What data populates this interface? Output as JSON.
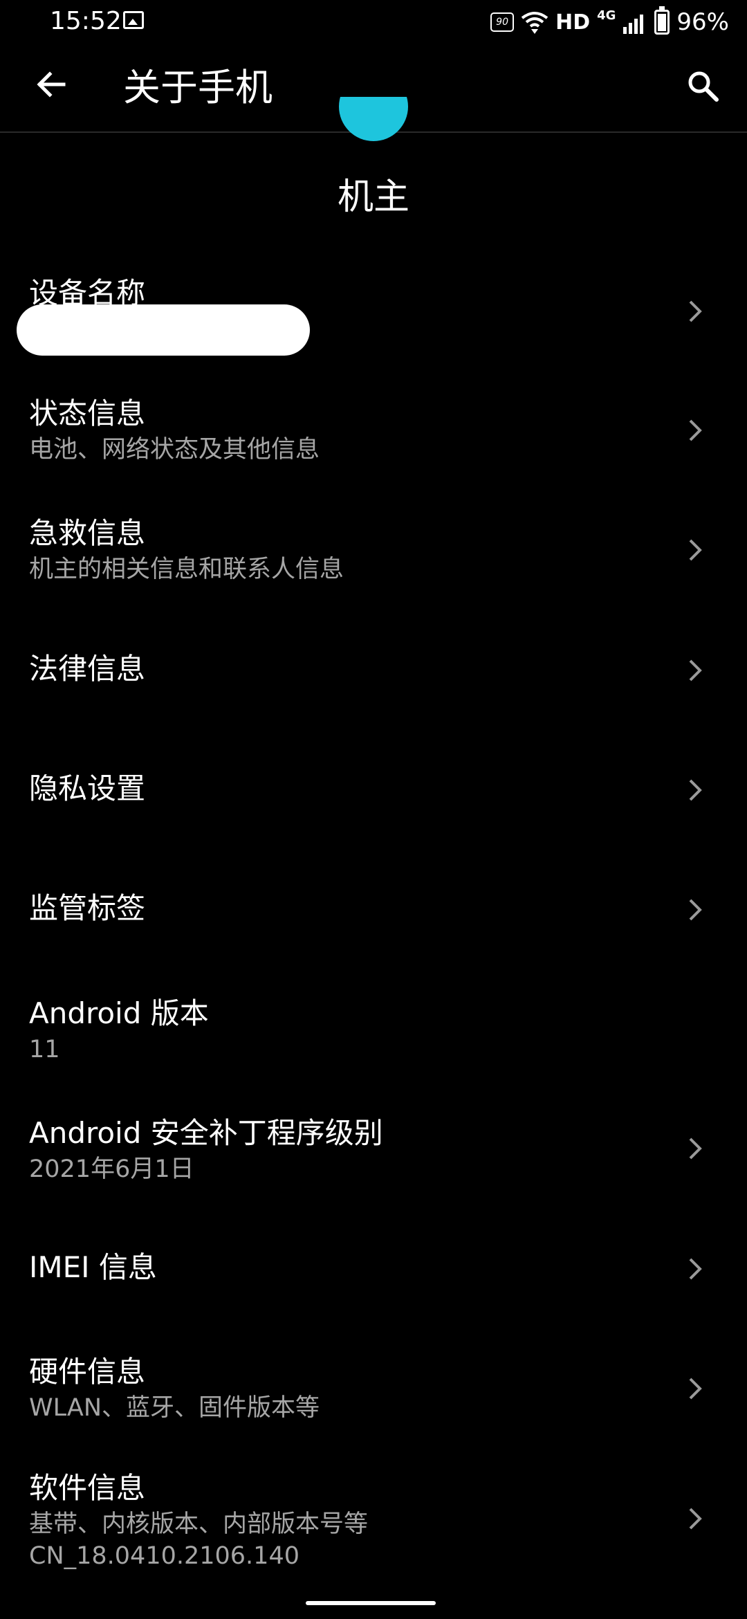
{
  "status_bar": {
    "time": "15:52",
    "refresh_rate": "90",
    "network": "HD",
    "network_type": "4G",
    "battery_percent": "96%",
    "battery_level": 0.96
  },
  "header": {
    "title": "关于手机"
  },
  "profile": {
    "owner_name": "机主",
    "avatar_color": "#1ec5dd"
  },
  "items": [
    {
      "title": "设备名称",
      "subtitle": ""
    },
    {
      "title": "状态信息",
      "subtitle": "电池、网络状态及其他信息"
    },
    {
      "title": "急救信息",
      "subtitle": "机主的相关信息和联系人信息"
    },
    {
      "title": "法律信息"
    },
    {
      "title": "隐私设置"
    },
    {
      "title": "监管标签"
    },
    {
      "title": "Android 版本",
      "subtitle": "11"
    },
    {
      "title": "Android 安全补丁程序级别",
      "subtitle": "2021年6月1日"
    },
    {
      "title": "IMEI 信息"
    },
    {
      "title": "硬件信息",
      "subtitle": "WLAN、蓝牙、固件版本等"
    },
    {
      "title": "软件信息",
      "subtitle": "基带、内核版本、内部版本号等",
      "subtitle2": "CN_18.0410.2106.140"
    }
  ]
}
